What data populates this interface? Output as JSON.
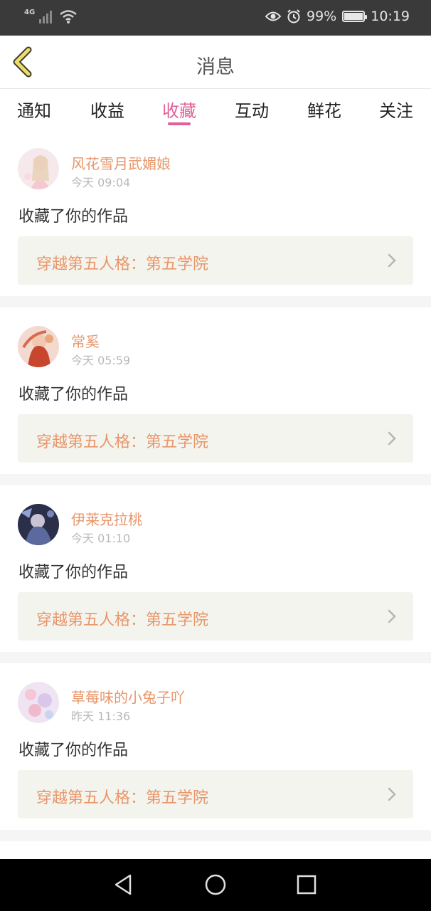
{
  "status_bar": {
    "network": "4G",
    "battery": "99%",
    "battery_level": 0.99,
    "time": "10:19",
    "icons": [
      "signal-icon",
      "wifi-icon",
      "eye-icon",
      "alarm-icon",
      "battery-icon"
    ]
  },
  "header": {
    "title": "消息",
    "back_icon": "chevron-left-icon"
  },
  "tabs": {
    "items": [
      {
        "label": "通知"
      },
      {
        "label": "收益"
      },
      {
        "label": "收藏"
      },
      {
        "label": "互动"
      },
      {
        "label": "鲜花"
      },
      {
        "label": "关注"
      }
    ],
    "active": "收藏"
  },
  "colors": {
    "accent": "#e0609a",
    "name_orange": "#e8966a",
    "box_bg": "#f4f4ee"
  },
  "messages": [
    {
      "user": "风花雪月武媚娘",
      "time": "今天 09:04",
      "action": "收藏了你的作品",
      "work": "穿越第五人格：第五学院"
    },
    {
      "user": "常奚",
      "time": "今天 05:59",
      "action": "收藏了你的作品",
      "work": "穿越第五人格：第五学院"
    },
    {
      "user": "伊莱克拉桃",
      "time": "今天 01:10",
      "action": "收藏了你的作品",
      "work": "穿越第五人格：第五学院"
    },
    {
      "user": "草莓味的小兔子吖",
      "time": "昨天 11:36",
      "action": "收藏了你的作品",
      "work": "穿越第五人格：第五学院"
    }
  ],
  "nav_bar": {
    "buttons": [
      "back-triangle-icon",
      "home-circle-icon",
      "recents-square-icon"
    ]
  }
}
